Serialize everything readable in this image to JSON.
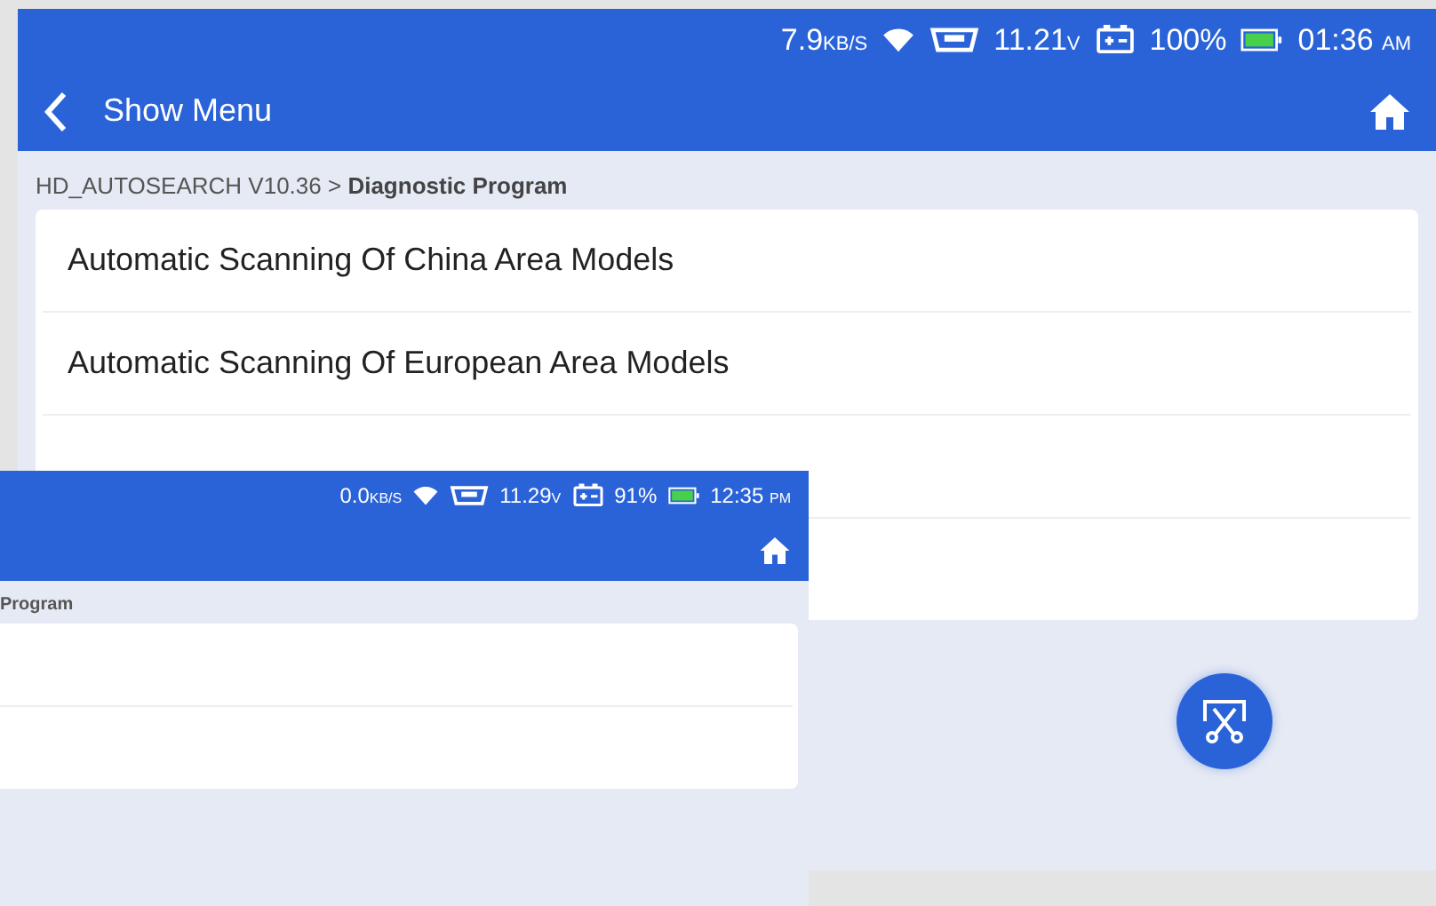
{
  "back_screen": {
    "status_bar": {
      "speed": "7.9",
      "speed_unit": "KB/S",
      "voltage": "11.21",
      "voltage_unit": "V",
      "battery": "100%",
      "time": "01:36",
      "meridiem": "AM"
    },
    "header": {
      "title": "Show Menu"
    },
    "breadcrumb": {
      "path": "HD_AUTOSEARCH V10.36 >",
      "current": "Diagnostic Program"
    },
    "menu_items": [
      {
        "label": "Automatic Scanning Of China Area Models"
      },
      {
        "label": "Automatic Scanning Of European Area Models"
      }
    ]
  },
  "front_screen": {
    "status_bar": {
      "speed": "0.0",
      "speed_unit": "KB/S",
      "voltage": "11.29",
      "voltage_unit": "V",
      "battery": "91%",
      "time": "12:35",
      "meridiem": "PM"
    },
    "breadcrumb": {
      "current": "Program"
    }
  }
}
